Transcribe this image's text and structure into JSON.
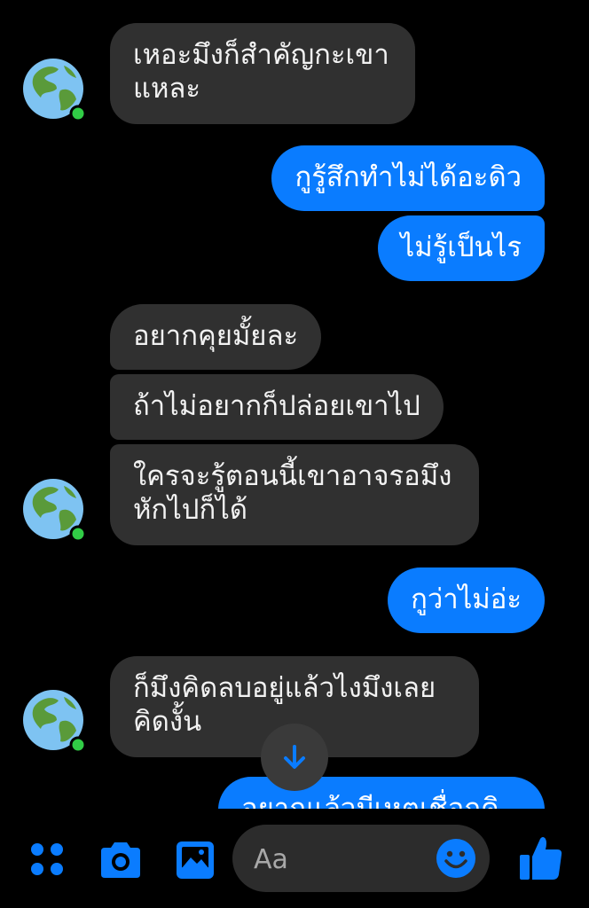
{
  "messages": [
    {
      "side": "in",
      "text": "เหอะมึงก็สำคัญกะเขา\nแหละ"
    },
    {
      "side": "out",
      "text": "กูรู้สึกทำไม่ได้อะดิว"
    },
    {
      "side": "out",
      "text": "ไม่รู้เป็นไร"
    },
    {
      "side": "in",
      "text": "อยากคุยมั้ยละ"
    },
    {
      "side": "in",
      "text": "ถ้าไม่อยากก็ปล่อยเขาไป"
    },
    {
      "side": "in",
      "text": "ใครจะรู้ตอนนี้เขาอาจรอมึง\nหักไปก็ได้"
    },
    {
      "side": "out",
      "text": "กูว่าไม่อ่ะ"
    },
    {
      "side": "in",
      "text": "ก็มึงคิดลบอยู่แล้วไงมึงเลย\nคิดงั้น"
    },
    {
      "side": "out",
      "text": "อยากแล้วมีเหตุเชื่อกคิ"
    }
  ],
  "composer": {
    "placeholder": "Aa"
  },
  "colors": {
    "accent": "#0a7cff",
    "incoming_bubble": "#303030",
    "background": "#000000",
    "online_dot": "#31cc46"
  },
  "icons": {
    "avatar": "globe-americas",
    "scroll": "arrow-down-icon",
    "menu": "four-dots-icon",
    "camera": "camera-icon",
    "gallery": "image-icon",
    "emoji": "smile-icon",
    "like": "thumbs-up-icon"
  }
}
